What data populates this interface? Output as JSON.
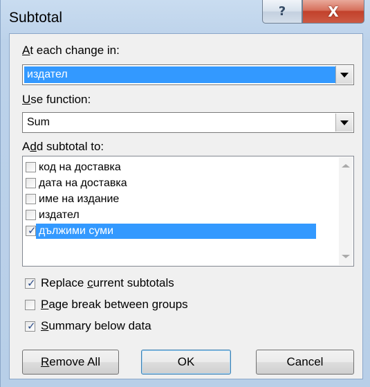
{
  "window": {
    "title": "Subtotal",
    "help_glyph": "?",
    "close_glyph": "X"
  },
  "at_each_change": {
    "label_prefix": "",
    "label_accel": "A",
    "label_rest": "t each change in:",
    "value": "издател"
  },
  "use_function": {
    "label_accel": "U",
    "label_rest": "se function:",
    "value": "Sum"
  },
  "add_subtotal": {
    "label_pre": "A",
    "label_accel": "d",
    "label_rest": "d subtotal to:",
    "items": [
      {
        "label": "код на доставка",
        "checked": false
      },
      {
        "label": "дата на доставка",
        "checked": false
      },
      {
        "label": "име на издание",
        "checked": false
      },
      {
        "label": "издател",
        "checked": false
      },
      {
        "label": "дължими суми",
        "checked": true
      }
    ]
  },
  "options": {
    "replace": {
      "pre": "Replace ",
      "accel": "c",
      "rest": "urrent subtotals",
      "checked": true
    },
    "page_break": {
      "pre": "",
      "accel": "P",
      "rest": "age break between groups",
      "checked": false
    },
    "summary": {
      "pre": "",
      "accel": "S",
      "rest": "ummary below data",
      "checked": true
    }
  },
  "buttons": {
    "remove_all_accel": "R",
    "remove_all_rest": "emove All",
    "ok": "OK",
    "cancel": "Cancel"
  },
  "colors": {
    "selection": "#3399ff",
    "dialog_bg": "#f0f0f0",
    "close_red": "#c2412b"
  }
}
